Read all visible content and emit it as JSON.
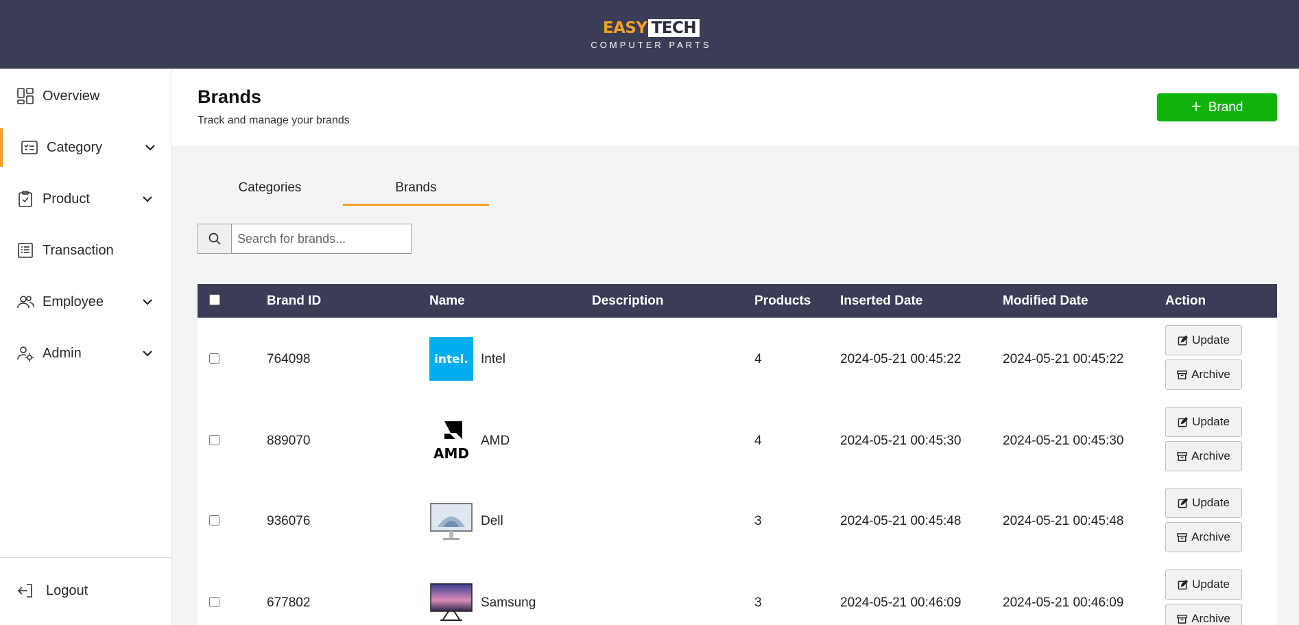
{
  "header": {
    "logo_easy": "EASY",
    "logo_tech": "TECH",
    "logo_sub": "COMPUTER PARTS"
  },
  "sidebar": {
    "items": [
      {
        "label": "Overview",
        "icon": "dashboard-icon"
      },
      {
        "label": "Category",
        "icon": "list-icon"
      },
      {
        "label": "Product",
        "icon": "clipboard-icon"
      },
      {
        "label": "Transaction",
        "icon": "receipt-icon"
      },
      {
        "label": "Employee",
        "icon": "users-icon"
      },
      {
        "label": "Admin",
        "icon": "user-gear-icon"
      }
    ],
    "logout_label": "Logout"
  },
  "page": {
    "title": "Brands",
    "subtitle": "Track and manage your brands",
    "add_button_label": "Brand"
  },
  "tabs": [
    {
      "label": "Categories"
    },
    {
      "label": "Brands"
    }
  ],
  "search": {
    "placeholder": "Search for brands...",
    "value": ""
  },
  "table": {
    "columns": [
      "Brand ID",
      "Name",
      "Description",
      "Products",
      "Inserted Date",
      "Modified Date",
      "Action"
    ],
    "update_label": "Update",
    "archive_label": "Archive",
    "rows": [
      {
        "id": "764098",
        "name": "Intel",
        "description": "",
        "products": "4",
        "inserted": "2024-05-21 00:45:22",
        "modified": "2024-05-21 00:45:22",
        "logo": "intel-logo"
      },
      {
        "id": "889070",
        "name": "AMD",
        "description": "",
        "products": "4",
        "inserted": "2024-05-21 00:45:30",
        "modified": "2024-05-21 00:45:30",
        "logo": "amd-logo"
      },
      {
        "id": "936076",
        "name": "Dell",
        "description": "",
        "products": "3",
        "inserted": "2024-05-21 00:45:48",
        "modified": "2024-05-21 00:45:48",
        "logo": "dell-monitor-image"
      },
      {
        "id": "677802",
        "name": "Samsung",
        "description": "",
        "products": "3",
        "inserted": "2024-05-21 00:46:09",
        "modified": "2024-05-21 00:46:09",
        "logo": "samsung-monitor-image"
      }
    ]
  },
  "colors": {
    "header_bg": "#3b3c56",
    "accent": "#f4a024",
    "add_button": "#10b30a"
  }
}
